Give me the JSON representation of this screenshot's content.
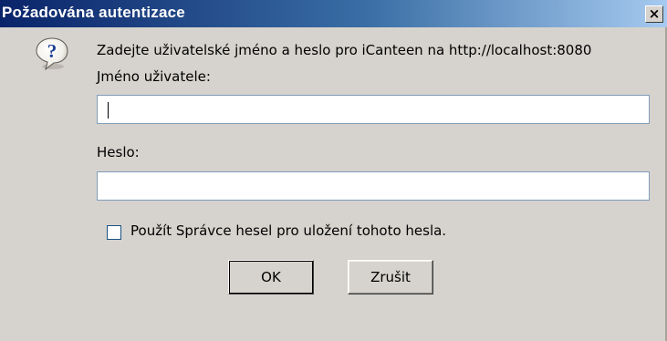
{
  "window": {
    "title": "Požadována autentizace",
    "close_symbol": "×"
  },
  "dialog": {
    "icon": "question-icon",
    "prompt": "Zadejte uživatelské jméno a heslo pro iCanteen na http://localhost:8080",
    "username_label": "Jméno uživatele:",
    "username_value": "",
    "password_label": "Heslo:",
    "password_value": "",
    "checkbox_label": "Použít Správce hesel pro uložení tohoto hesla.",
    "checkbox_checked": false,
    "ok_label": "OK",
    "cancel_label": "Zrušit"
  },
  "colors": {
    "title_gradient_start": "#0a246a",
    "title_gradient_end": "#a6caf0",
    "dialog_bg": "#d6d3ce",
    "input_border": "#7f9db9"
  }
}
